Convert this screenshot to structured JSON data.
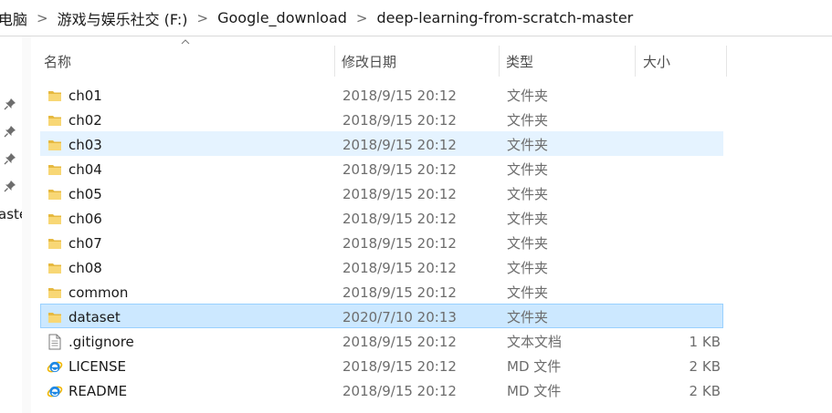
{
  "breadcrumb": [
    "电脑",
    "游戏与娱乐社交 (F:)",
    "Google_download",
    "deep-learning-from-scratch-master"
  ],
  "breadcrumb_separator": ">",
  "navpane": {
    "partial_text": "aste"
  },
  "columns": {
    "name": "名称",
    "date": "修改日期",
    "type": "类型",
    "size": "大小"
  },
  "files": [
    {
      "icon": "folder-icon",
      "name": "ch01",
      "date": "2018/9/15 20:12",
      "type": "文件夹",
      "size": "",
      "state": ""
    },
    {
      "icon": "folder-icon",
      "name": "ch02",
      "date": "2018/9/15 20:12",
      "type": "文件夹",
      "size": "",
      "state": ""
    },
    {
      "icon": "folder-icon",
      "name": "ch03",
      "date": "2018/9/15 20:12",
      "type": "文件夹",
      "size": "",
      "state": "hover"
    },
    {
      "icon": "folder-icon",
      "name": "ch04",
      "date": "2018/9/15 20:12",
      "type": "文件夹",
      "size": "",
      "state": ""
    },
    {
      "icon": "folder-icon",
      "name": "ch05",
      "date": "2018/9/15 20:12",
      "type": "文件夹",
      "size": "",
      "state": ""
    },
    {
      "icon": "folder-icon",
      "name": "ch06",
      "date": "2018/9/15 20:12",
      "type": "文件夹",
      "size": "",
      "state": ""
    },
    {
      "icon": "folder-icon",
      "name": "ch07",
      "date": "2018/9/15 20:12",
      "type": "文件夹",
      "size": "",
      "state": ""
    },
    {
      "icon": "folder-icon",
      "name": "ch08",
      "date": "2018/9/15 20:12",
      "type": "文件夹",
      "size": "",
      "state": ""
    },
    {
      "icon": "folder-icon",
      "name": "common",
      "date": "2018/9/15 20:12",
      "type": "文件夹",
      "size": "",
      "state": ""
    },
    {
      "icon": "folder-icon",
      "name": "dataset",
      "date": "2020/7/10 20:13",
      "type": "文件夹",
      "size": "",
      "state": "selected"
    },
    {
      "icon": "text-file-icon",
      "name": ".gitignore",
      "date": "2018/9/15 20:12",
      "type": "文本文档",
      "size": "1 KB",
      "state": ""
    },
    {
      "icon": "ie-file-icon",
      "name": "LICENSE",
      "date": "2018/9/15 20:12",
      "type": "MD 文件",
      "size": "2 KB",
      "state": ""
    },
    {
      "icon": "ie-file-icon",
      "name": "README",
      "date": "2018/9/15 20:12",
      "type": "MD 文件",
      "size": "2 KB",
      "state": ""
    }
  ],
  "colors": {
    "hover": "#e5f3ff",
    "selected": "#cce8ff",
    "selected_border": "#99d1ff",
    "folder": "#f8d775",
    "folder_dark": "#e6b940",
    "ie_blue": "#1e88e5",
    "ie_ring": "#f2b705"
  }
}
